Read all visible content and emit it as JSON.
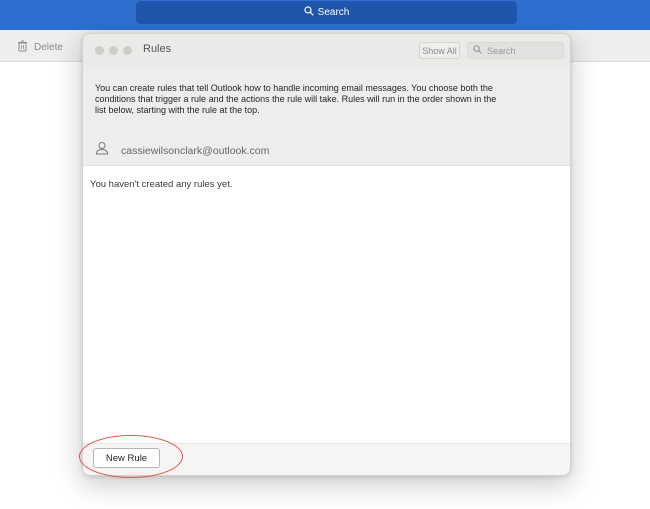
{
  "app": {
    "search_label": "Search",
    "toolbar": {
      "delete_label": "Delete"
    }
  },
  "dialog": {
    "title": "Rules",
    "show_all_label": "Show All",
    "search_placeholder": "Search",
    "description": "You can create rules that tell Outlook how to handle incoming email messages. You choose both the conditions that trigger a rule and the actions the rule will take. Rules will run in the order shown in the list below, starting with the rule at the top.",
    "account_email": "cassiewilsonclark@outlook.com",
    "empty_message": "You haven't created any rules yet.",
    "new_rule_label": "New Rule"
  },
  "colors": {
    "topbar": "#2f6fd0",
    "search_pill": "#1f55ab",
    "annotation": "#d75a4a"
  },
  "icons": {
    "top_search": "search-icon",
    "delete": "trash-icon",
    "dialog_search": "search-icon",
    "account": "person-icon"
  }
}
